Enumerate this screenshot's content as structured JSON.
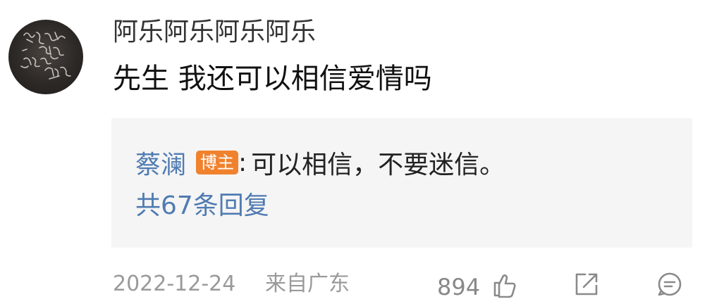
{
  "comment": {
    "username": "阿乐阿乐阿乐阿乐",
    "text": "先生 我还可以相信爱情吗",
    "reply": {
      "author": "蔡澜",
      "badge": "博主",
      "colon": ":",
      "text": "可以相信，不要迷信。",
      "total_replies": "共67条回复"
    },
    "meta": {
      "date": "2022-12-24",
      "location": "来自广东",
      "likes": "894"
    }
  },
  "colors": {
    "link_blue": "#4f7bb2",
    "badge_orange": "#f0822e",
    "reply_bg": "#f5f5f5",
    "meta_gray": "#9a9a9a"
  },
  "icons": {
    "like": "thumbs-up-icon",
    "share": "share-icon",
    "comment": "comment-icon"
  }
}
